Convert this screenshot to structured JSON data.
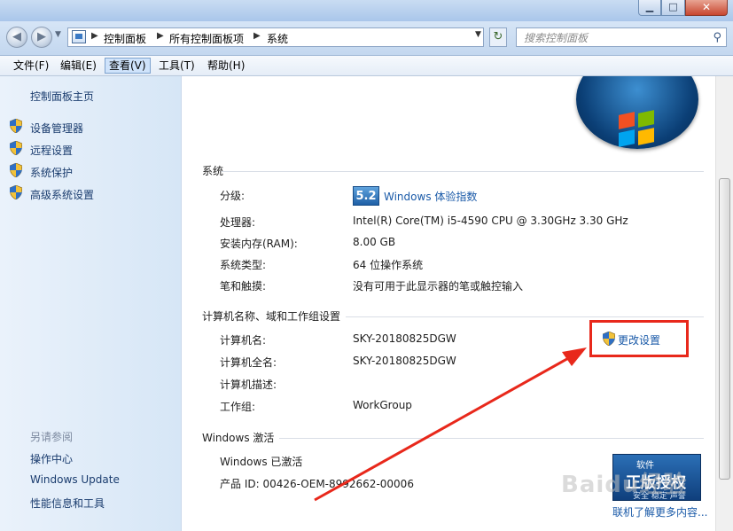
{
  "window": {
    "colors": {
      "title_gradient_top": "#c9dcf2",
      "accent_link": "#1a5aa8",
      "highlight_red": "#e8281b"
    }
  },
  "address": {
    "crumbs": [
      "控制面板",
      "所有控制面板项",
      "系统"
    ]
  },
  "search": {
    "placeholder": "搜索控制面板"
  },
  "menu": {
    "items": [
      {
        "label": "文件(F)"
      },
      {
        "label": "编辑(E)"
      },
      {
        "label": "查看(V)"
      },
      {
        "label": "工具(T)"
      },
      {
        "label": "帮助(H)"
      }
    ],
    "active_index": 2
  },
  "sidebar": {
    "home": "控制面板主页",
    "links": [
      {
        "label": "设备管理器",
        "icon": "uac-shield-icon"
      },
      {
        "label": "远程设置",
        "icon": "uac-shield-icon"
      },
      {
        "label": "系统保护",
        "icon": "uac-shield-icon"
      },
      {
        "label": "高级系统设置",
        "icon": "uac-shield-icon"
      }
    ],
    "see_also_title": "另请参阅",
    "see_also": [
      "操作中心",
      "Windows Update",
      "性能信息和工具"
    ]
  },
  "system": {
    "section_title": "系统",
    "rating_label": "分级:",
    "rating_score": "5.2",
    "rating_link": "Windows 体验指数",
    "processor_label": "处理器:",
    "processor_value": "Intel(R) Core(TM) i5-4590 CPU @ 3.30GHz   3.30 GHz",
    "ram_label": "安装内存(RAM):",
    "ram_value": "8.00 GB",
    "type_label": "系统类型:",
    "type_value": "64 位操作系统",
    "pen_label": "笔和触摸:",
    "pen_value": "没有可用于此显示器的笔或触控输入"
  },
  "computer": {
    "section_title": "计算机名称、域和工作组设置",
    "name_label": "计算机名:",
    "name_value": "SKY-20180825DGW",
    "fullname_label": "计算机全名:",
    "fullname_value": "SKY-20180825DGW",
    "desc_label": "计算机描述:",
    "desc_value": "",
    "workgroup_label": "工作组:",
    "workgroup_value": "WorkGroup",
    "change_settings": "更改设置"
  },
  "activation": {
    "section_title": "Windows 激活",
    "status": "Windows 已激活",
    "product_id": "产品 ID: 00426-OEM-8992662-00006",
    "badge_line1": "软件",
    "badge_line2": "正版授权",
    "badge_line3": "安全 稳定 声誉",
    "learn_more": "联机了解更多内容..."
  },
  "watermark": "Baidu经验"
}
